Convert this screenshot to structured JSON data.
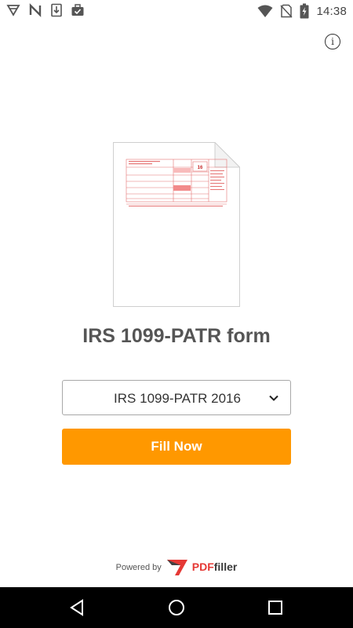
{
  "status_bar": {
    "time": "14:38",
    "left_icons": [
      "app-notification-icon",
      "n-notification-icon",
      "download-icon",
      "briefcase-check-icon"
    ],
    "right_icons": [
      "wifi-icon",
      "no-sim-icon",
      "battery-charging-icon"
    ]
  },
  "form": {
    "title": "IRS 1099-PATR form",
    "selected_year": "IRS 1099-PATR 2016",
    "fill_label": "Fill Now"
  },
  "footer": {
    "powered_label": "Powered by",
    "brand_pdf": "PDF",
    "brand_filler": "filler"
  },
  "colors": {
    "accent": "#ff9800",
    "brand_red": "#e53935",
    "title_text": "#555555"
  }
}
